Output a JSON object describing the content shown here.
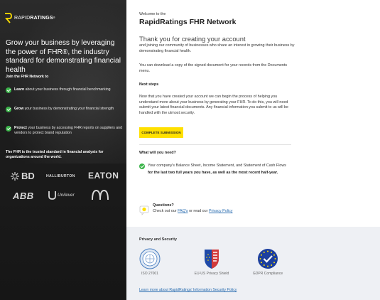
{
  "brand": {
    "logo_text_prefix": "RAPID",
    "logo_text_suffix": "RATINGS",
    "trademark": "®"
  },
  "left": {
    "headline": "Grow your business by leveraging the power of FHR®, the industry standard for demonstrating financial health",
    "join_title": "Join the FHR Network to",
    "benefits": [
      {
        "bold": "Learn",
        "text": " about your business through financial benchmarking"
      },
      {
        "bold": "Grow",
        "text": " your business by demonstrating your financial strength"
      },
      {
        "bold": "Protect",
        "text": " your business by accessing FHR reports on suppliers and vendors to protect brand reputation"
      }
    ],
    "trusted": "The FHR is the trusted standard in financial analysis for organizations around the world.",
    "brands": [
      "BD",
      "HALLIBURTON",
      "EATON",
      "ABB",
      "Unilever",
      "McDonald's"
    ]
  },
  "main": {
    "welcome": "Welcome to the",
    "title": "RapidRatings FHR Network",
    "thanks": "Thank you for creating your account",
    "intro": "and joining our community of businesses who share an interest in growing their business by demonstrating financial health.",
    "download": "You can download a copy of the signed document for your records from the Documents menu.",
    "next_title": "Next steps",
    "next_body": "Now that you have created your account we can begin the process of helping you understand more about your business by generating your FHR. To do this, you will need submit your latest financial documents. Any financial information you submit to us will be handled with the utmost security.",
    "button_label": "COMPLETE SUBMISSION",
    "need_title": "What will you need?",
    "need_plain": "Your company's Balance Sheet, Income Statement, and Statement of Cash Flows ",
    "need_bold": "for the last two full years you have, as well as the most recent half-year.",
    "questions_title": "Questions?",
    "questions_prefix": "Check out our ",
    "faq_link": "FAQ's",
    "questions_mid": " or read our ",
    "privacy_link": "Privacy Policy"
  },
  "security": {
    "title": "Privacy and Security",
    "badges": [
      {
        "label": "ISO 27001",
        "icon": "iso-27001-seal-icon"
      },
      {
        "label": "EU-US Privacy Shield",
        "icon": "privacy-shield-icon"
      },
      {
        "label": "GDPR Compliance",
        "icon": "gdpr-compliance-icon"
      }
    ],
    "link": "Learn more about RapidRatings' Information Security Policy"
  },
  "colors": {
    "accent_yellow": "#ffe000",
    "check_green": "#3bb44a",
    "link_blue": "#2a6db0",
    "left_bg": "#1c1c1c"
  }
}
